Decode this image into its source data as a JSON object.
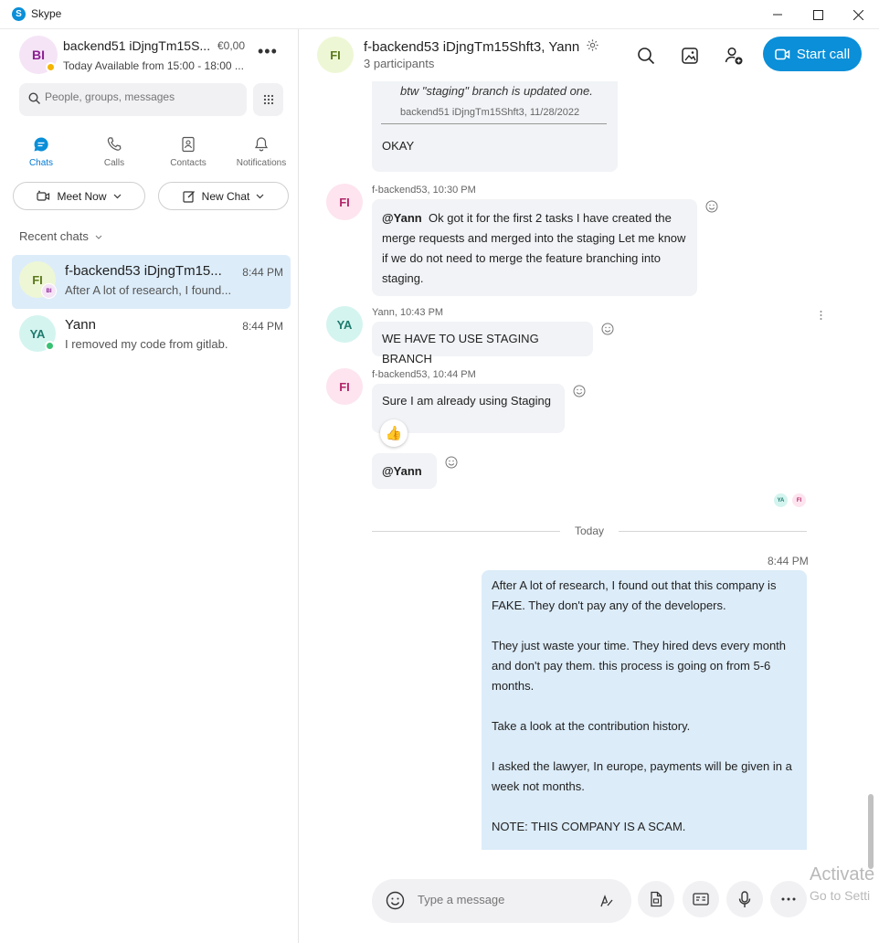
{
  "window": {
    "title": "Skype",
    "controls": {
      "minimize": "minimize-icon",
      "maximize": "maximize-icon",
      "close": "close-icon"
    }
  },
  "profile": {
    "initials": "BI",
    "name": "backend51 iDjngTm15S...",
    "credit": "€0,00",
    "status": "Today Available from 15:00 - 18:00 ...",
    "status_color": "#f4b400"
  },
  "search": {
    "placeholder": "People, groups, messages"
  },
  "nav": [
    {
      "label": "Chats",
      "icon": "chat-icon",
      "active": true
    },
    {
      "label": "Calls",
      "icon": "phone-icon",
      "active": false
    },
    {
      "label": "Contacts",
      "icon": "contacts-icon",
      "active": false
    },
    {
      "label": "Notifications",
      "icon": "bell-icon",
      "active": false
    }
  ],
  "actions": {
    "meet_now": "Meet Now",
    "new_chat": "New Chat"
  },
  "recent_label": "Recent chats",
  "chats": [
    {
      "initials": "FI",
      "badge": "BI",
      "name": "f-backend53 iDjngTm15...",
      "time": "8:44 PM",
      "preview": "After A lot of research, I found..."
    },
    {
      "initials": "YA",
      "name": "Yann",
      "time": "8:44 PM",
      "preview": "I removed my code from gitlab."
    }
  ],
  "conversation": {
    "initials": "FI",
    "title": "f-backend53 iDjngTm15Shft3, Yann",
    "participants": "3 participants",
    "start_call": "Start call"
  },
  "messages": {
    "quote_text": "btw \"staging\" branch is updated one.",
    "quote_meta": "backend51 iDjngTm15Shft3, 11/28/2022",
    "okay": "OKAY",
    "m1_meta": "f-backend53, 10:30 PM",
    "m1_mention": "@Yann",
    "m1_text": "Ok got it for the first 2 tasks I have created the merge requests and merged into the staging Let me know if we do not need to merge the feature branching into staging.",
    "m2_meta": "Yann, 10:43 PM",
    "m2_text": "WE HAVE TO USE STAGING BRANCH",
    "m3_meta": "f-backend53, 10:44 PM",
    "m3_text": "Sure I am already using Staging",
    "m3_reaction": "👍",
    "m4_text": "@Yann",
    "read_by": [
      "YA",
      "FI"
    ],
    "divider": "Today",
    "own_time": "8:44 PM",
    "own_paragraphs": [
      "After A lot of research, I found out that this company is FAKE. They don't pay any of the developers.",
      "They just waste your time. They hired devs every month and don't pay them. this process is going on from 5-6 months.",
      "Take a look at the contribution history.",
      "I asked the lawyer, In europe, payments will be given in a week not months.",
      "NOTE: THIS COMPANY IS A SCAM."
    ]
  },
  "composer": {
    "placeholder": "Type a message"
  },
  "watermark": {
    "line1": "Activate",
    "line2": "Go to Setti"
  },
  "colors": {
    "accent": "#0a8fd8",
    "own_bubble": "#dcecf9",
    "bubble": "#f1f3f6"
  }
}
